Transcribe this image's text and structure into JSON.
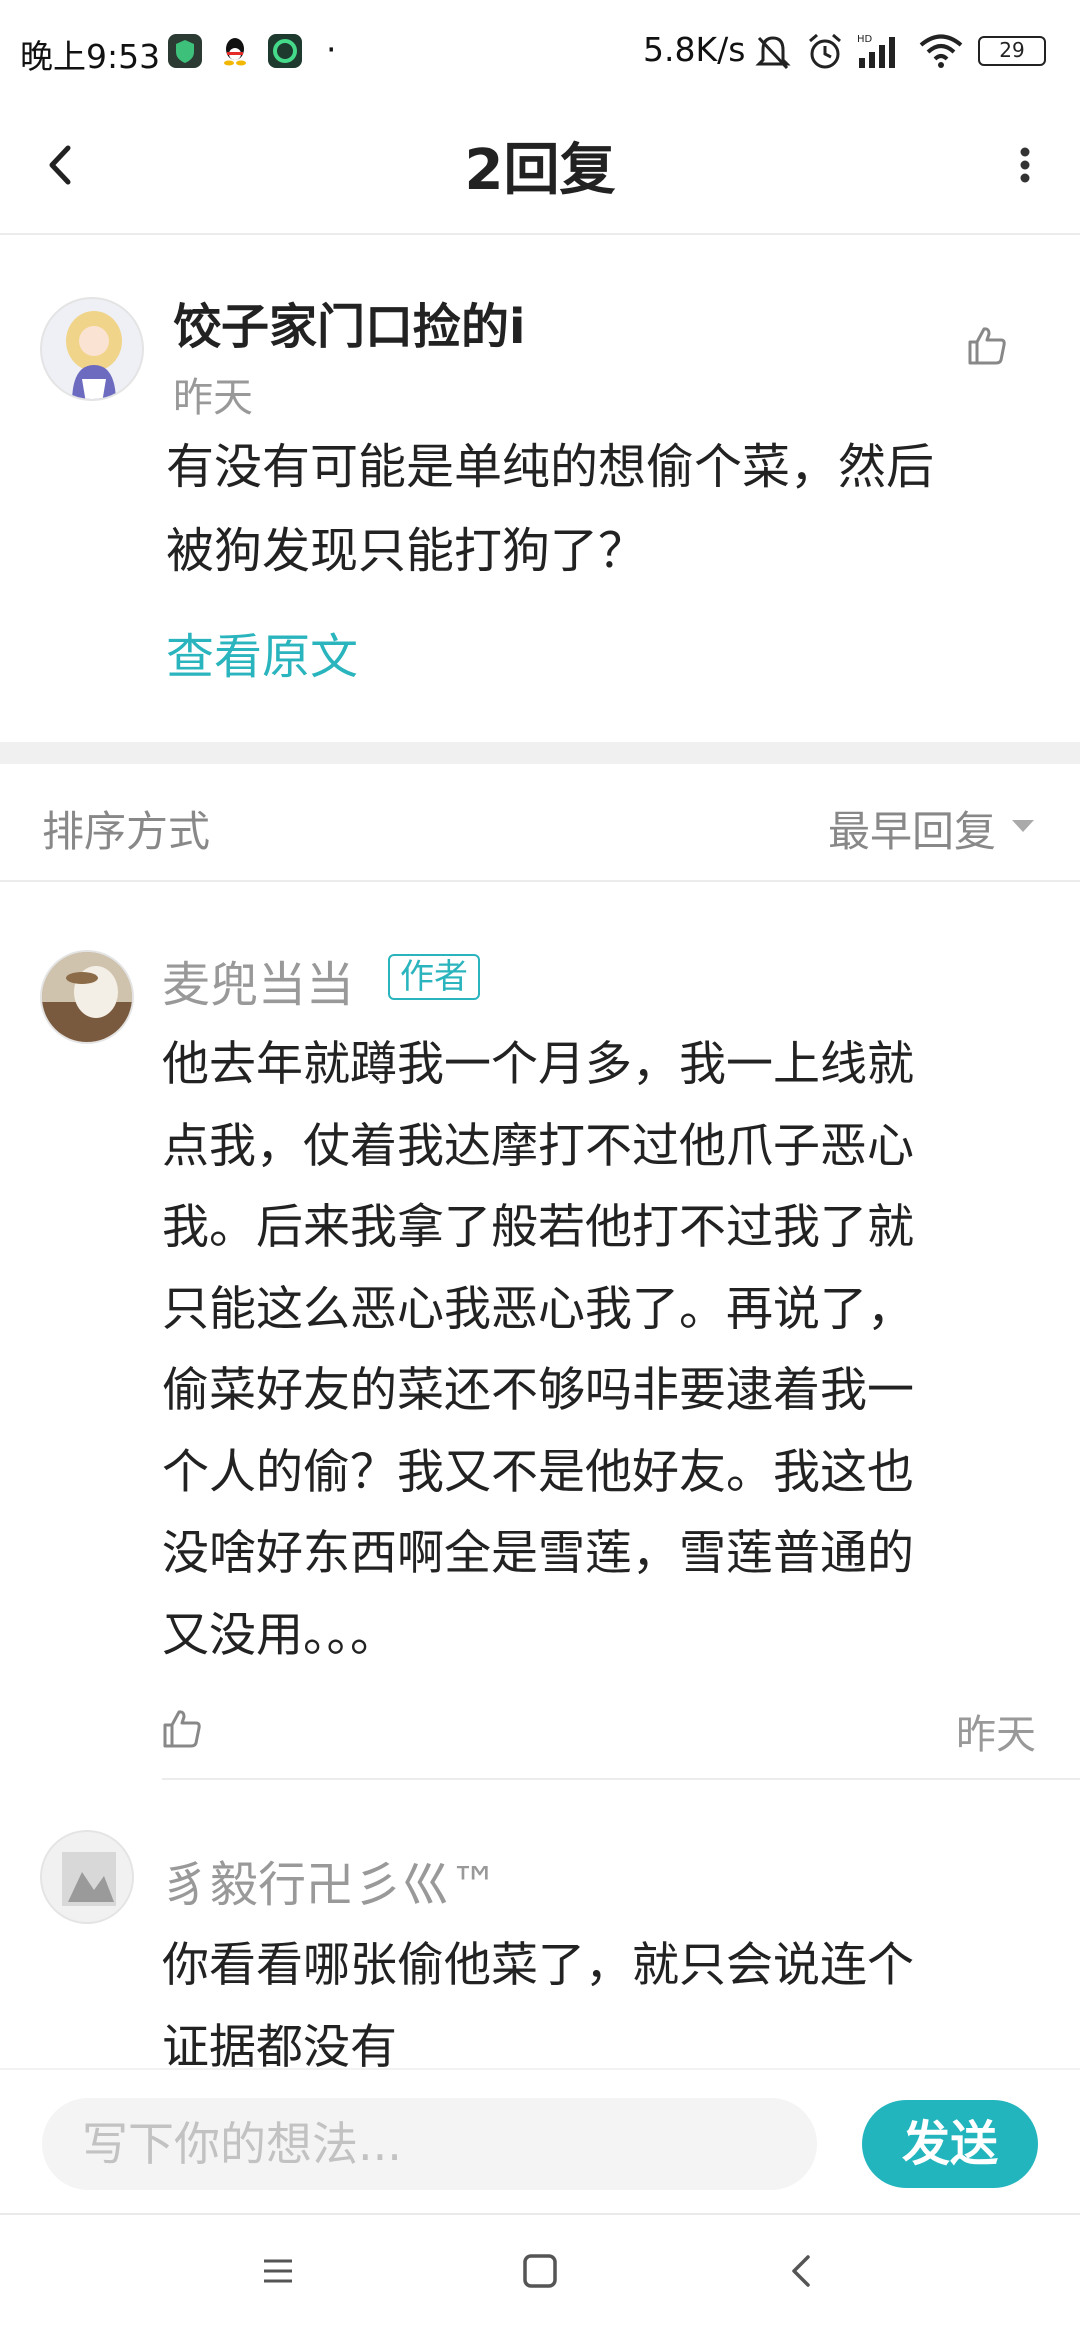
{
  "status_bar": {
    "time": "晚上9:53",
    "dot": "·",
    "net_speed": "5.8K/s",
    "battery": "29"
  },
  "header": {
    "title": "2回复"
  },
  "post": {
    "author": "饺子家门口捡的i",
    "time": "昨天",
    "content_lines": [
      "有没有可能是单纯的想偷个菜，然后",
      "被狗发现只能打狗了？"
    ],
    "view_original": "查看原文"
  },
  "sort": {
    "label": "排序方式",
    "value": "最早回复"
  },
  "replies": [
    {
      "name": "麦兜当当",
      "badge": "作者",
      "lines": [
        "他去年就蹲我一个月多，我一上线就",
        "点我，仗着我达摩打不过他爪子恶心",
        "我。后来我拿了般若他打不过我了就",
        "只能这么恶心我恶心我了。再说了，",
        "偷菜好友的菜还不够吗非要逮着我一",
        "个人的偷？我又不是他好友。我这也",
        "没啥好东西啊全是雪莲，雪莲普通的",
        "又没用。。。"
      ],
      "time": "昨天"
    },
    {
      "name": "豸毅行卍彡巛™",
      "lines": [
        "你看看哪张偷他菜了，就只会说连个",
        "证据都没有"
      ]
    }
  ],
  "input": {
    "placeholder": "写下你的想法...",
    "send_label": "发送"
  },
  "colors": {
    "accent": "#22b5be",
    "link": "#2ab4bd"
  }
}
